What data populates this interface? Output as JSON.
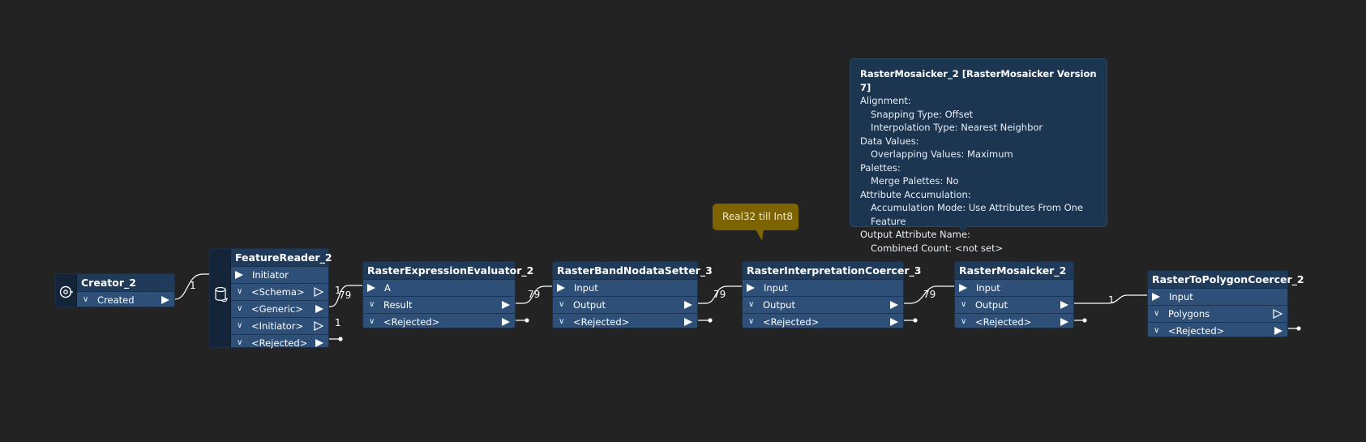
{
  "nodes": {
    "creator": {
      "title": "Creator_2",
      "outputs": [
        "Created"
      ]
    },
    "feature_reader": {
      "title": "FeatureReader_2",
      "inputs": [
        "Initiator"
      ],
      "outputs": [
        "<Schema>",
        "<Generic>",
        "<Initiator>",
        "<Rejected>"
      ]
    },
    "expression_evaluator": {
      "title": "RasterExpressionEvaluator_2",
      "inputs": [
        "A"
      ],
      "outputs": [
        "Result",
        "<Rejected>"
      ]
    },
    "nodata_setter": {
      "title": "RasterBandNodataSetter_3",
      "inputs": [
        "Input"
      ],
      "outputs": [
        "Output",
        "<Rejected>"
      ]
    },
    "interpretation_coercer": {
      "title": "RasterInterpretationCoercer_3",
      "inputs": [
        "Input"
      ],
      "outputs": [
        "Output",
        "<Rejected>"
      ]
    },
    "mosaicker": {
      "title": "RasterMosaicker_2",
      "inputs": [
        "Input"
      ],
      "outputs": [
        "Output",
        "<Rejected>"
      ]
    },
    "polygon_coercer": {
      "title": "RasterToPolygonCoercer_2",
      "inputs": [
        "Input"
      ],
      "outputs": [
        "Polygons",
        "<Rejected>"
      ]
    }
  },
  "connection_counts": {
    "creator_to_reader": "1",
    "reader_generic": "1",
    "reader_to_evaluator": "79",
    "reader_initiator": "1",
    "evaluator_to_setter": "79",
    "setter_to_coercer": "79",
    "coercer_to_mosaicker": "79",
    "mosaicker_to_polygon": "1"
  },
  "annotation": {
    "text": "Real32 till Int8"
  },
  "tooltip": {
    "header": "RasterMosaicker_2 [RasterMosaicker Version 7]",
    "lines": [
      {
        "text": "Alignment:",
        "indent": false
      },
      {
        "text": "Snapping Type: Offset",
        "indent": true
      },
      {
        "text": "Interpolation Type: Nearest Neighbor",
        "indent": true
      },
      {
        "text": "Data Values:",
        "indent": false
      },
      {
        "text": "Overlapping Values: Maximum",
        "indent": true
      },
      {
        "text": "Palettes:",
        "indent": false
      },
      {
        "text": "Merge Palettes: No",
        "indent": true
      },
      {
        "text": "Attribute Accumulation:",
        "indent": false
      },
      {
        "text": "Accumulation Mode: Use Attributes From One Feature",
        "indent": true
      },
      {
        "text": "Output Attribute Name:",
        "indent": false
      },
      {
        "text": "Combined Count: <not set>",
        "indent": true
      }
    ]
  },
  "colors": {
    "background": "#232323",
    "node_body": "#2e5078",
    "node_title": "#203a5a",
    "annotation": "#7d6401",
    "tooltip": "#1c3550"
  }
}
